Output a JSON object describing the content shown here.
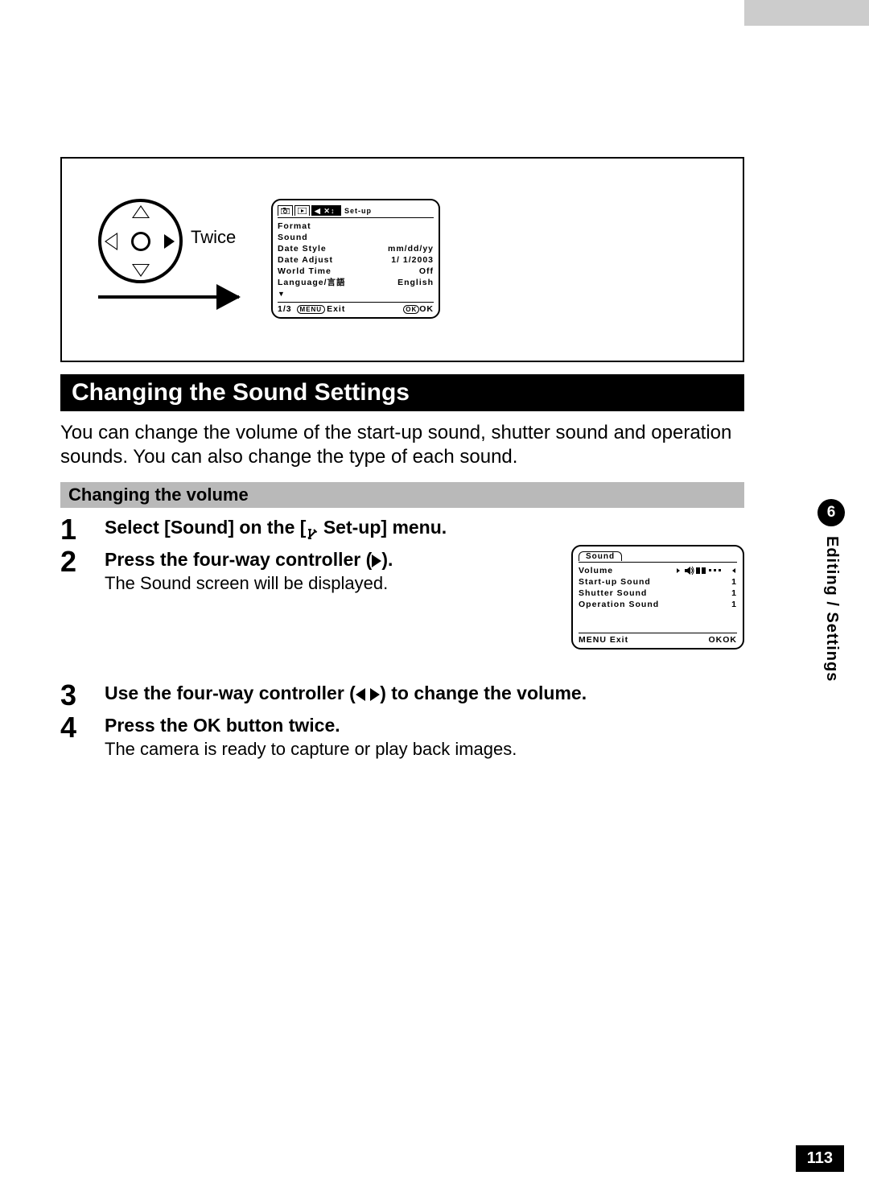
{
  "illustration": {
    "twice_label": "Twice",
    "lcd": {
      "setup_tab_label": "Set-up",
      "rows": [
        {
          "label": "Format",
          "value": ""
        },
        {
          "label": "Sound",
          "value": ""
        },
        {
          "label": "Date Style",
          "value": "mm/dd/yy"
        },
        {
          "label": "Date Adjust",
          "value": "1/ 1/2003"
        },
        {
          "label": "World Time",
          "value": "Off"
        },
        {
          "label": "Language/言語",
          "value": "English"
        }
      ],
      "page_indicator": "1/3",
      "menu_label": "MENU",
      "exit_label": "Exit",
      "ok_badge": "OK",
      "ok_label": "OK"
    }
  },
  "section_title": "Changing the Sound Settings",
  "intro_text": "You can change the volume of the start-up sound, shutter sound and operation sounds. You can also change the type of each sound.",
  "sub_title": "Changing the volume",
  "steps": {
    "s1": {
      "num": "1",
      "head_a": "Select [Sound] on the [",
      "head_b": " Set-up] menu."
    },
    "s2": {
      "num": "2",
      "head_a": "Press the four-way controller (",
      "head_b": ").",
      "desc": "The Sound screen will be displayed."
    },
    "s3": {
      "num": "3",
      "head_a": "Use the four-way controller (",
      "head_b": ") to change the volume."
    },
    "s4": {
      "num": "4",
      "head": "Press the OK button twice.",
      "desc": "The camera is ready to capture or play back images."
    }
  },
  "sound_lcd": {
    "tab": "Sound",
    "rows": [
      {
        "label": "Volume",
        "value": ""
      },
      {
        "label": "Start-up Sound",
        "value": "1"
      },
      {
        "label": "Shutter Sound",
        "value": "1"
      },
      {
        "label": "Operation Sound",
        "value": "1"
      }
    ],
    "menu_label": "MENU",
    "exit_label": "Exit",
    "ok_badge": "OK",
    "ok_label": "OK"
  },
  "sidebar": {
    "chapter_num": "6",
    "chapter_title": "Editing / Settings"
  },
  "page_number": "113"
}
